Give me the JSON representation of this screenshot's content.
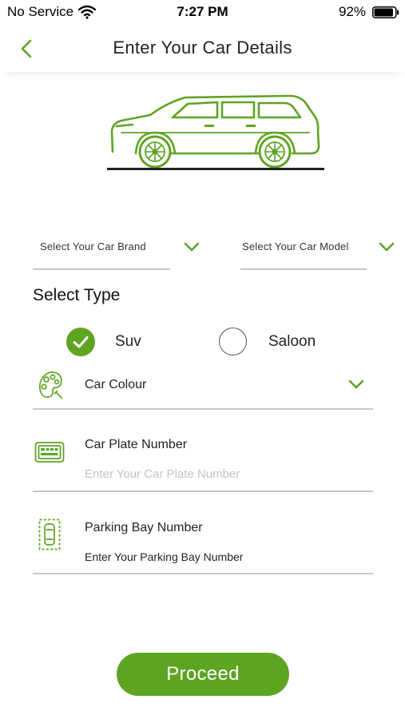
{
  "status_bar": {
    "carrier": "No Service",
    "time": "7:27 PM",
    "battery": "92%",
    "battery_level": 0.92
  },
  "header": {
    "title": "Enter Your Car Details",
    "back_icon": "chevron-left-icon"
  },
  "selectors": {
    "brand_label": "Select Your Car Brand",
    "model_label": "Select Your Car Model"
  },
  "type_section": {
    "title": "Select Type",
    "options": [
      {
        "label": "Suv",
        "selected": true
      },
      {
        "label": "Saloon",
        "selected": false
      }
    ]
  },
  "fields": {
    "colour": {
      "label": "Car Colour",
      "icon": "palette-icon"
    },
    "plate": {
      "label": "Car Plate Number",
      "placeholder": "Enter Your Car Plate Number",
      "value": "",
      "icon": "license-plate-icon"
    },
    "parking": {
      "label": "Parking Bay Number",
      "placeholder": "",
      "value": "Enter Your Parking Bay Number",
      "icon": "parking-bay-icon"
    }
  },
  "proceed_label": "Proceed",
  "colors": {
    "accent": "#5ea423",
    "divider": "#c8c8c8",
    "placeholder": "#c3c3c3"
  }
}
